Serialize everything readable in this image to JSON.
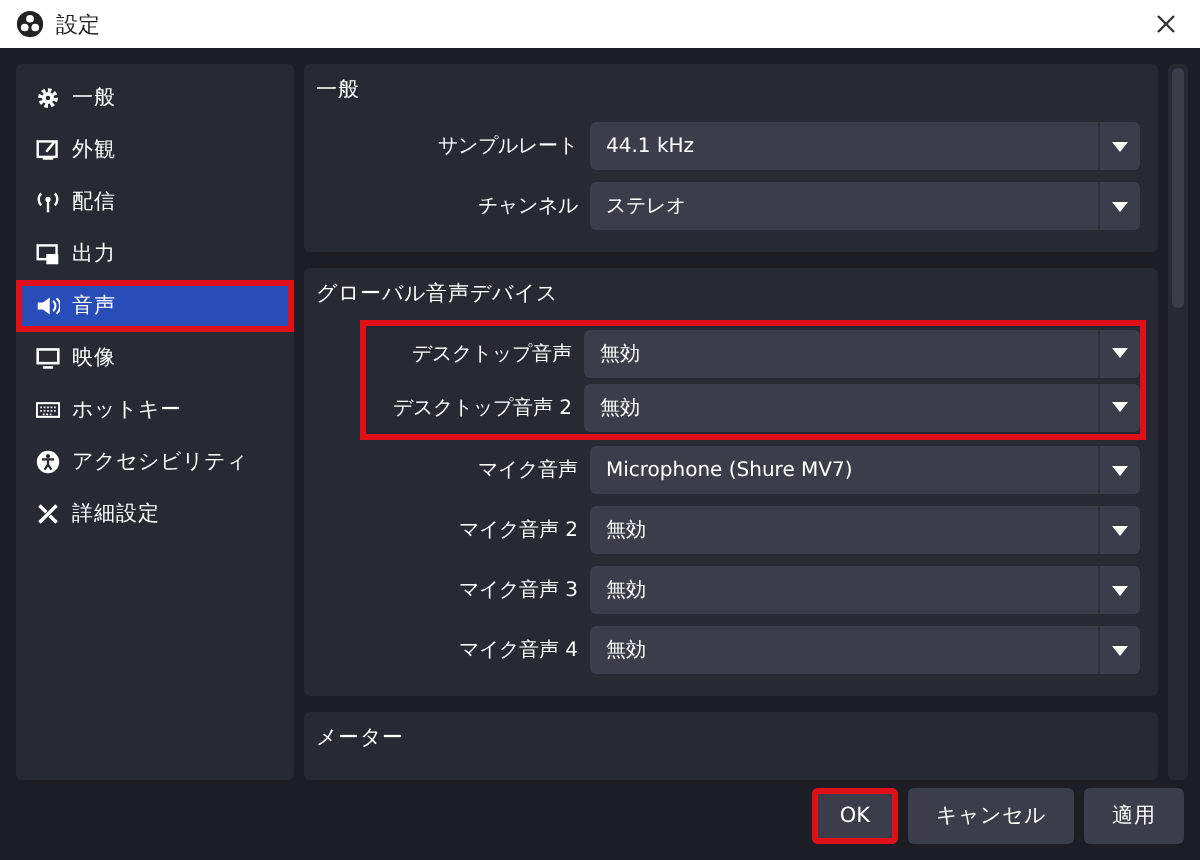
{
  "window": {
    "title": "設定"
  },
  "sidebar": {
    "items": [
      {
        "label": "一般",
        "selected": false,
        "highlighted": false
      },
      {
        "label": "外観",
        "selected": false,
        "highlighted": false
      },
      {
        "label": "配信",
        "selected": false,
        "highlighted": false
      },
      {
        "label": "出力",
        "selected": false,
        "highlighted": false
      },
      {
        "label": "音声",
        "selected": true,
        "highlighted": true
      },
      {
        "label": "映像",
        "selected": false,
        "highlighted": false
      },
      {
        "label": "ホットキー",
        "selected": false,
        "highlighted": false
      },
      {
        "label": "アクセシビリティ",
        "selected": false,
        "highlighted": false
      },
      {
        "label": "詳細設定",
        "selected": false,
        "highlighted": false
      }
    ]
  },
  "sections": [
    {
      "title": "一般",
      "rows": [
        {
          "label": "サンプルレート",
          "value": "44.1 kHz",
          "highlighted": false
        },
        {
          "label": "チャンネル",
          "value": "ステレオ",
          "highlighted": false
        }
      ]
    },
    {
      "title": "グローバル音声デバイス",
      "rows": [
        {
          "label": "デスクトップ音声",
          "value": "無効",
          "highlighted": true
        },
        {
          "label": "デスクトップ音声 2",
          "value": "無効",
          "highlighted": true
        },
        {
          "label": "マイク音声",
          "value": "Microphone (Shure MV7)",
          "highlighted": false
        },
        {
          "label": "マイク音声 2",
          "value": "無効",
          "highlighted": false
        },
        {
          "label": "マイク音声 3",
          "value": "無効",
          "highlighted": false
        },
        {
          "label": "マイク音声 4",
          "value": "無効",
          "highlighted": false
        }
      ]
    },
    {
      "title": "メーター"
    }
  ],
  "buttons": [
    {
      "label": "OK",
      "highlighted": true
    },
    {
      "label": "キャンセル",
      "highlighted": false
    },
    {
      "label": "適用",
      "highlighted": false
    }
  ]
}
